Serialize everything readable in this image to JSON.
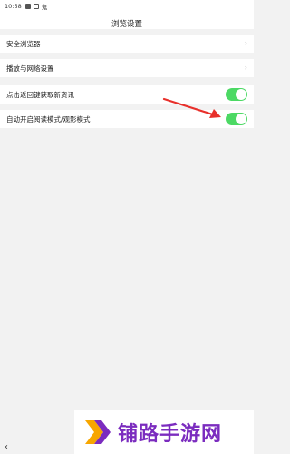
{
  "status_bar": {
    "time": "10:58",
    "icons": [
      "gallery-icon",
      "square-icon"
    ],
    "extra_char": "鬼"
  },
  "header": {
    "title": "浏览设置"
  },
  "settings": {
    "items": [
      {
        "label": "安全浏览器",
        "type": "link",
        "icon": "chevron-right-icon"
      },
      {
        "label": "播放与网络设置",
        "type": "link",
        "icon": "chevron-right-icon"
      },
      {
        "label": "点击返回键获取新资讯",
        "type": "toggle",
        "enabled": true
      },
      {
        "label": "自动开启阅读模式/观影模式",
        "type": "toggle",
        "enabled": true
      }
    ]
  },
  "colors": {
    "toggle_on": "#4cd964",
    "arrow": "#e8302b",
    "watermark_text": "#7b2cbf"
  },
  "nav": {
    "back_icon": "chevron-left-icon"
  },
  "watermark": {
    "text": "铺路手游网"
  }
}
